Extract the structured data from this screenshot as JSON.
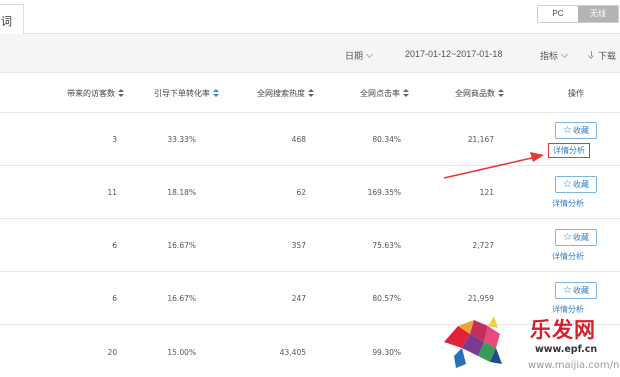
{
  "tabs": {
    "active_partial": "词"
  },
  "device_toggle": {
    "pc": "PC",
    "wireless": "无线"
  },
  "filters": {
    "date_label": "日期",
    "date_range": "2017-01-12~2017-01-18",
    "metric_label": "指标",
    "download_label": "下载"
  },
  "table": {
    "headers": [
      "带来的访客数",
      "引导下单转化率",
      "全网搜索热度",
      "全网点击率",
      "全网商品数",
      "操作"
    ],
    "rows": [
      {
        "visitors": "3",
        "conversion": "33.33%",
        "search_heat": "468",
        "click_rate": "80.34%",
        "goods": "21,167"
      },
      {
        "visitors": "11",
        "conversion": "18.18%",
        "search_heat": "62",
        "click_rate": "169.35%",
        "goods": "121"
      },
      {
        "visitors": "6",
        "conversion": "16.67%",
        "search_heat": "357",
        "click_rate": "75.63%",
        "goods": "2,727"
      },
      {
        "visitors": "6",
        "conversion": "16.67%",
        "search_heat": "247",
        "click_rate": "80.57%",
        "goods": "21,959"
      },
      {
        "visitors": "20",
        "conversion": "15.00%",
        "search_heat": "43,405",
        "click_rate": "99.30%",
        "goods": ""
      }
    ],
    "actions": {
      "favorite": "收藏",
      "detail": "详情分析"
    }
  },
  "annotation": {
    "color": "#e53935"
  },
  "watermark": {
    "brand": "乐发网",
    "url": "www.epf.cn",
    "site": "www.maijia.com/news"
  },
  "colors": {
    "link": "#2f7fc8",
    "header_bg": "#f4f5f7",
    "active_sort": "#2f8ee0"
  }
}
